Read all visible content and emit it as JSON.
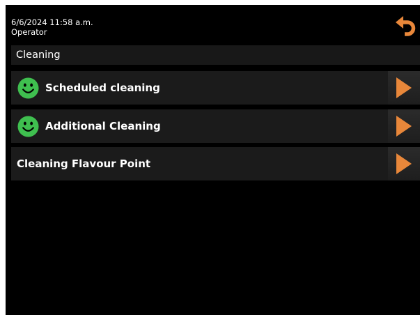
{
  "header": {
    "datetime": "6/6/2024 11:58 a.m.",
    "user_role": "Operator",
    "back_icon": "back-arrow-icon",
    "accent_color": "#e8873a"
  },
  "section": {
    "title": "Cleaning"
  },
  "menu": {
    "items": [
      {
        "label": "Scheduled cleaning",
        "status_icon": "smiley-icon",
        "status_color": "#3fbf4f"
      },
      {
        "label": "Additional Cleaning",
        "status_icon": "smiley-icon",
        "status_color": "#3fbf4f"
      },
      {
        "label": "Cleaning Flavour Point"
      }
    ]
  }
}
